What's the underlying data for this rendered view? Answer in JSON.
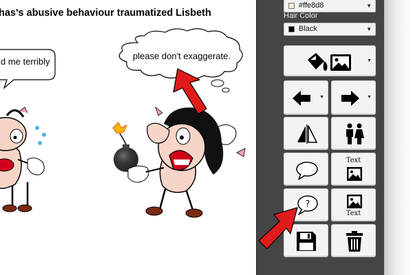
{
  "canvas": {
    "headline": "has's abusive behaviour traumatized Lisbeth",
    "left_bubble_text": "d me terribly",
    "right_bubble_text": "please don't exaggerate."
  },
  "panel": {
    "skin_select": {
      "value": "#ffe8d8",
      "swatch_color": "#ffe8d8"
    },
    "hair_label": "Hair Color",
    "hair_select": {
      "value": "Black",
      "swatch_color": "#000000"
    },
    "buttons": {
      "fill_image": {
        "icon": "paint-bucket-icon",
        "icon2": "image-icon"
      },
      "back": {
        "icon": "arrow-left-icon"
      },
      "forward": {
        "icon": "arrow-right-icon"
      },
      "flip": {
        "icon": "flip-horizontal-icon"
      },
      "characters": {
        "icon": "people-icon"
      },
      "speech": {
        "icon": "speech-bubble-icon"
      },
      "text_image_top": {
        "caption": "Text"
      },
      "thought": {
        "icon": "thought-bubble-icon"
      },
      "text_image_bottom": {
        "caption": "Text"
      },
      "save": {
        "icon": "save-icon"
      },
      "delete": {
        "icon": "trash-icon"
      }
    }
  },
  "colors": {
    "panel_bg": "#454545",
    "button_bg": "#f3f3f3",
    "arrow_red": "#e01b1b"
  }
}
